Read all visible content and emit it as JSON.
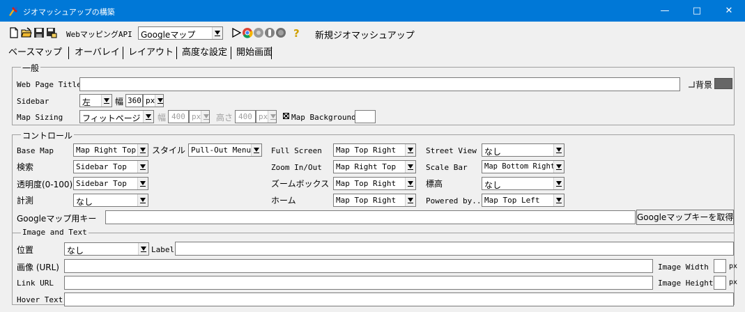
{
  "window": {
    "title": "ジオマッシュアップの構築",
    "minimize": "—",
    "maximize": "□",
    "close": "✕",
    "titlebar_color": "#0078d7"
  },
  "toolbar": {
    "icons": [
      "new-file-icon",
      "open-folder-icon",
      "save-icon",
      "save-as-icon"
    ],
    "map_api_label": "WebマッピングAPI",
    "map_api_value": "Googleマップ",
    "browser_icons": [
      "play-icon",
      "chrome-icon",
      "circle-gray-icon",
      "toggle-icon",
      "record-icon"
    ],
    "help_icon": "question-mark-icon",
    "new_mashup": "新規ジオマッシュアップ"
  },
  "tabs": [
    {
      "label": "ベースマップ"
    },
    {
      "label": "オーバレイ"
    },
    {
      "label": "レイアウト",
      "selected": true
    },
    {
      "label": "高度な設定"
    },
    {
      "label": "開始画面"
    }
  ],
  "general": {
    "title": "一般",
    "web_page_title_label": "Web Page Title",
    "web_page_title_value": "",
    "background_label": "背景",
    "background_color": "#666666",
    "sidebar_label": "Sidebar",
    "sidebar_side": "左",
    "width_label": "幅",
    "sidebar_width": "360",
    "sidebar_unit": "px",
    "map_sizing_label": "Map Sizing",
    "map_sizing_value": "フィットページ",
    "map_width_label": "幅",
    "map_width": "400",
    "map_width_unit": "px",
    "map_height_label": "高さ",
    "map_height": "400",
    "map_height_unit": "px",
    "map_background_label": "Map Background",
    "map_background_checked": true
  },
  "controls": {
    "title": "コントロール",
    "base_map_label": "Base Map",
    "base_map_value": "Map Right Top",
    "style_label": "スタイル",
    "style_value": "Pull-Out Menu",
    "full_screen_label": "Full Screen",
    "full_screen_value": "Map Top Right",
    "street_view_label": "Street View",
    "street_view_value": "なし",
    "search_label": "検索",
    "search_value": "Sidebar Top",
    "zoom_label": "Zoom In/Out",
    "zoom_value": "Map Right Top",
    "scale_bar_label": "Scale Bar",
    "scale_bar_value": "Map Bottom Right",
    "opacity_label": "透明度(0-100)",
    "opacity_value": "Sidebar Top",
    "zoom_box_label": "ズームボックス",
    "zoom_box_value": "Map Top Right",
    "elevation_label": "標高",
    "elevation_value": "なし",
    "measure_label": "計測",
    "measure_value": "なし",
    "home_label": "ホーム",
    "home_value": "Map Top Right",
    "powered_by_label": "Powered by...",
    "powered_by_value": "Map Top Left",
    "gmap_key_label": "Googleマップ用キー",
    "gmap_key_value": "",
    "get_key_button": "Googleマップキーを取得"
  },
  "image_text": {
    "title": "Image and Text",
    "position_label": "位置",
    "position_value": "なし",
    "label_label": "Label",
    "label_value": "",
    "image_url_label": "画像 (URL)",
    "image_url_value": "",
    "image_width_label": "Image Width",
    "image_width_value": "",
    "px_label": "px",
    "link_url_label": "Link URL",
    "link_url_value": "",
    "image_height_label": "Image Height",
    "image_height_value": "",
    "px_label2": "px",
    "hover_text_label": "Hover Text",
    "hover_text_value": ""
  }
}
